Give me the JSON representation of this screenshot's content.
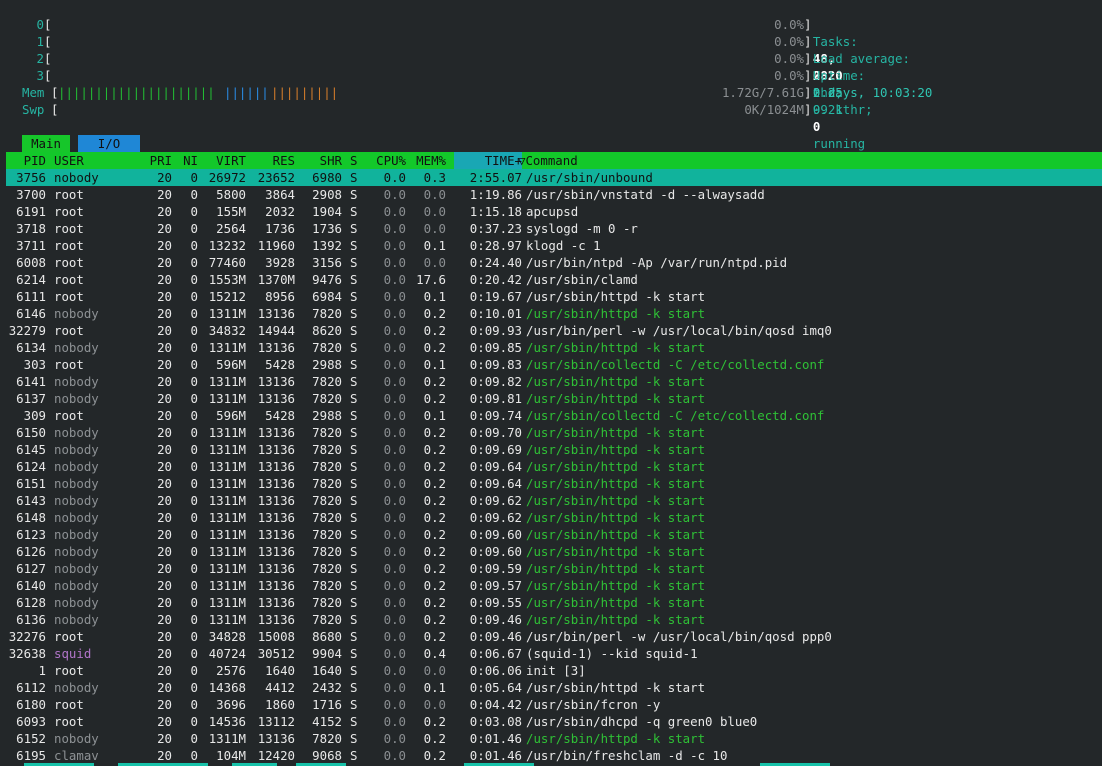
{
  "cpus": [
    {
      "id": "0",
      "pct": "0.0%"
    },
    {
      "id": "1",
      "pct": "0.0%"
    },
    {
      "id": "2",
      "pct": "0.0%"
    },
    {
      "id": "3",
      "pct": "0.0%"
    }
  ],
  "mem": {
    "label": "Mem",
    "bar_green": "|||||||||||||||||||||",
    "bar_blue": "||||||",
    "bar_orange": "|||||||||",
    "value": "1.72G/7.61G"
  },
  "swp": {
    "label": "Swp",
    "value": "0K/1024M"
  },
  "tasks": {
    "label": "Tasks:",
    "count": "48,",
    "thr": "28",
    "thr_label": "thr,",
    "kthr": "99 kthr;",
    "running": "0",
    "running_label": "running"
  },
  "load": {
    "label": "Load average:",
    "l1": "0.20",
    "l5": "0.25",
    "l15": "0.21"
  },
  "uptime": {
    "label": "Uptime:",
    "value": "2 days, 10:03:20"
  },
  "tabs": [
    {
      "label": "Main"
    },
    {
      "label": "I/O"
    }
  ],
  "columns": {
    "pid": "PID",
    "user": "USER",
    "pri": "PRI",
    "ni": "NI",
    "virt": "VIRT",
    "res": "RES",
    "shr": "SHR",
    "s": "S",
    "cpu": "CPU%",
    "mem": "MEM%",
    "time": "TIME+",
    "cmd": "▽Command"
  },
  "processes": [
    {
      "pid": "3756",
      "user": "nobody",
      "pri": "20",
      "ni": "0",
      "virt": "26972",
      "res": "23652",
      "shr": "6980",
      "s": "S",
      "cpu": "0.0",
      "mem": "0.3",
      "time": "2:55.07",
      "cmd": "/usr/sbin/unbound",
      "thread": false
    },
    {
      "pid": "3700",
      "user": "root",
      "pri": "20",
      "ni": "0",
      "virt": "5800",
      "res": "3864",
      "shr": "2908",
      "s": "S",
      "cpu": "0.0",
      "mem": "0.0",
      "time": "1:19.86",
      "cmd": "/usr/sbin/vnstatd -d --alwaysadd",
      "thread": false
    },
    {
      "pid": "6191",
      "user": "root",
      "pri": "20",
      "ni": "0",
      "virt": "155M",
      "res": "2032",
      "shr": "1904",
      "s": "S",
      "cpu": "0.0",
      "mem": "0.0",
      "time": "1:15.18",
      "cmd": "apcupsd",
      "thread": false
    },
    {
      "pid": "3718",
      "user": "root",
      "pri": "20",
      "ni": "0",
      "virt": "2564",
      "res": "1736",
      "shr": "1736",
      "s": "S",
      "cpu": "0.0",
      "mem": "0.0",
      "time": "0:37.23",
      "cmd": "syslogd -m 0 -r",
      "thread": false
    },
    {
      "pid": "3711",
      "user": "root",
      "pri": "20",
      "ni": "0",
      "virt": "13232",
      "res": "11960",
      "shr": "1392",
      "s": "S",
      "cpu": "0.0",
      "mem": "0.1",
      "time": "0:28.97",
      "cmd": "klogd -c 1",
      "thread": false
    },
    {
      "pid": "6008",
      "user": "root",
      "pri": "20",
      "ni": "0",
      "virt": "77460",
      "res": "3928",
      "shr": "3156",
      "s": "S",
      "cpu": "0.0",
      "mem": "0.0",
      "time": "0:24.40",
      "cmd": "/usr/bin/ntpd -Ap /var/run/ntpd.pid",
      "thread": false
    },
    {
      "pid": "6214",
      "user": "root",
      "pri": "20",
      "ni": "0",
      "virt": "1553M",
      "res": "1370M",
      "shr": "9476",
      "s": "S",
      "cpu": "0.0",
      "mem": "17.6",
      "time": "0:20.42",
      "cmd": "/usr/sbin/clamd",
      "thread": false
    },
    {
      "pid": "6111",
      "user": "root",
      "pri": "20",
      "ni": "0",
      "virt": "15212",
      "res": "8956",
      "shr": "6984",
      "s": "S",
      "cpu": "0.0",
      "mem": "0.1",
      "time": "0:19.67",
      "cmd": "/usr/sbin/httpd -k start",
      "thread": false
    },
    {
      "pid": "6146",
      "user": "nobody",
      "pri": "20",
      "ni": "0",
      "virt": "1311M",
      "res": "13136",
      "shr": "7820",
      "s": "S",
      "cpu": "0.0",
      "mem": "0.2",
      "time": "0:10.01",
      "cmd": "/usr/sbin/httpd -k start",
      "thread": true
    },
    {
      "pid": "32279",
      "user": "root",
      "pri": "20",
      "ni": "0",
      "virt": "34832",
      "res": "14944",
      "shr": "8620",
      "s": "S",
      "cpu": "0.0",
      "mem": "0.2",
      "time": "0:09.93",
      "cmd": "/usr/bin/perl -w /usr/local/bin/qosd imq0",
      "thread": false
    },
    {
      "pid": "6134",
      "user": "nobody",
      "pri": "20",
      "ni": "0",
      "virt": "1311M",
      "res": "13136",
      "shr": "7820",
      "s": "S",
      "cpu": "0.0",
      "mem": "0.2",
      "time": "0:09.85",
      "cmd": "/usr/sbin/httpd -k start",
      "thread": true
    },
    {
      "pid": "303",
      "user": "root",
      "pri": "20",
      "ni": "0",
      "virt": "596M",
      "res": "5428",
      "shr": "2988",
      "s": "S",
      "cpu": "0.0",
      "mem": "0.1",
      "time": "0:09.83",
      "cmd": "/usr/sbin/collectd -C /etc/collectd.conf",
      "thread": true
    },
    {
      "pid": "6141",
      "user": "nobody",
      "pri": "20",
      "ni": "0",
      "virt": "1311M",
      "res": "13136",
      "shr": "7820",
      "s": "S",
      "cpu": "0.0",
      "mem": "0.2",
      "time": "0:09.82",
      "cmd": "/usr/sbin/httpd -k start",
      "thread": true
    },
    {
      "pid": "6137",
      "user": "nobody",
      "pri": "20",
      "ni": "0",
      "virt": "1311M",
      "res": "13136",
      "shr": "7820",
      "s": "S",
      "cpu": "0.0",
      "mem": "0.2",
      "time": "0:09.81",
      "cmd": "/usr/sbin/httpd -k start",
      "thread": true
    },
    {
      "pid": "309",
      "user": "root",
      "pri": "20",
      "ni": "0",
      "virt": "596M",
      "res": "5428",
      "shr": "2988",
      "s": "S",
      "cpu": "0.0",
      "mem": "0.1",
      "time": "0:09.74",
      "cmd": "/usr/sbin/collectd -C /etc/collectd.conf",
      "thread": true
    },
    {
      "pid": "6150",
      "user": "nobody",
      "pri": "20",
      "ni": "0",
      "virt": "1311M",
      "res": "13136",
      "shr": "7820",
      "s": "S",
      "cpu": "0.0",
      "mem": "0.2",
      "time": "0:09.70",
      "cmd": "/usr/sbin/httpd -k start",
      "thread": true
    },
    {
      "pid": "6145",
      "user": "nobody",
      "pri": "20",
      "ni": "0",
      "virt": "1311M",
      "res": "13136",
      "shr": "7820",
      "s": "S",
      "cpu": "0.0",
      "mem": "0.2",
      "time": "0:09.69",
      "cmd": "/usr/sbin/httpd -k start",
      "thread": true
    },
    {
      "pid": "6124",
      "user": "nobody",
      "pri": "20",
      "ni": "0",
      "virt": "1311M",
      "res": "13136",
      "shr": "7820",
      "s": "S",
      "cpu": "0.0",
      "mem": "0.2",
      "time": "0:09.64",
      "cmd": "/usr/sbin/httpd -k start",
      "thread": true
    },
    {
      "pid": "6151",
      "user": "nobody",
      "pri": "20",
      "ni": "0",
      "virt": "1311M",
      "res": "13136",
      "shr": "7820",
      "s": "S",
      "cpu": "0.0",
      "mem": "0.2",
      "time": "0:09.64",
      "cmd": "/usr/sbin/httpd -k start",
      "thread": true
    },
    {
      "pid": "6143",
      "user": "nobody",
      "pri": "20",
      "ni": "0",
      "virt": "1311M",
      "res": "13136",
      "shr": "7820",
      "s": "S",
      "cpu": "0.0",
      "mem": "0.2",
      "time": "0:09.62",
      "cmd": "/usr/sbin/httpd -k start",
      "thread": true
    },
    {
      "pid": "6148",
      "user": "nobody",
      "pri": "20",
      "ni": "0",
      "virt": "1311M",
      "res": "13136",
      "shr": "7820",
      "s": "S",
      "cpu": "0.0",
      "mem": "0.2",
      "time": "0:09.62",
      "cmd": "/usr/sbin/httpd -k start",
      "thread": true
    },
    {
      "pid": "6123",
      "user": "nobody",
      "pri": "20",
      "ni": "0",
      "virt": "1311M",
      "res": "13136",
      "shr": "7820",
      "s": "S",
      "cpu": "0.0",
      "mem": "0.2",
      "time": "0:09.60",
      "cmd": "/usr/sbin/httpd -k start",
      "thread": true
    },
    {
      "pid": "6126",
      "user": "nobody",
      "pri": "20",
      "ni": "0",
      "virt": "1311M",
      "res": "13136",
      "shr": "7820",
      "s": "S",
      "cpu": "0.0",
      "mem": "0.2",
      "time": "0:09.60",
      "cmd": "/usr/sbin/httpd -k start",
      "thread": true
    },
    {
      "pid": "6127",
      "user": "nobody",
      "pri": "20",
      "ni": "0",
      "virt": "1311M",
      "res": "13136",
      "shr": "7820",
      "s": "S",
      "cpu": "0.0",
      "mem": "0.2",
      "time": "0:09.59",
      "cmd": "/usr/sbin/httpd -k start",
      "thread": true
    },
    {
      "pid": "6140",
      "user": "nobody",
      "pri": "20",
      "ni": "0",
      "virt": "1311M",
      "res": "13136",
      "shr": "7820",
      "s": "S",
      "cpu": "0.0",
      "mem": "0.2",
      "time": "0:09.57",
      "cmd": "/usr/sbin/httpd -k start",
      "thread": true
    },
    {
      "pid": "6128",
      "user": "nobody",
      "pri": "20",
      "ni": "0",
      "virt": "1311M",
      "res": "13136",
      "shr": "7820",
      "s": "S",
      "cpu": "0.0",
      "mem": "0.2",
      "time": "0:09.55",
      "cmd": "/usr/sbin/httpd -k start",
      "thread": true
    },
    {
      "pid": "6136",
      "user": "nobody",
      "pri": "20",
      "ni": "0",
      "virt": "1311M",
      "res": "13136",
      "shr": "7820",
      "s": "S",
      "cpu": "0.0",
      "mem": "0.2",
      "time": "0:09.46",
      "cmd": "/usr/sbin/httpd -k start",
      "thread": true
    },
    {
      "pid": "32276",
      "user": "root",
      "pri": "20",
      "ni": "0",
      "virt": "34828",
      "res": "15008",
      "shr": "8680",
      "s": "S",
      "cpu": "0.0",
      "mem": "0.2",
      "time": "0:09.46",
      "cmd": "/usr/bin/perl -w /usr/local/bin/qosd ppp0",
      "thread": false
    },
    {
      "pid": "32638",
      "user": "squid",
      "pri": "20",
      "ni": "0",
      "virt": "40724",
      "res": "30512",
      "shr": "9904",
      "s": "S",
      "cpu": "0.0",
      "mem": "0.4",
      "time": "0:06.67",
      "cmd": "(squid-1) --kid squid-1",
      "thread": false
    },
    {
      "pid": "1",
      "user": "root",
      "pri": "20",
      "ni": "0",
      "virt": "2576",
      "res": "1640",
      "shr": "1640",
      "s": "S",
      "cpu": "0.0",
      "mem": "0.0",
      "time": "0:06.06",
      "cmd": "init [3]",
      "thread": false
    },
    {
      "pid": "6112",
      "user": "nobody",
      "pri": "20",
      "ni": "0",
      "virt": "14368",
      "res": "4412",
      "shr": "2432",
      "s": "S",
      "cpu": "0.0",
      "mem": "0.1",
      "time": "0:05.64",
      "cmd": "/usr/sbin/httpd -k start",
      "thread": false
    },
    {
      "pid": "6180",
      "user": "root",
      "pri": "20",
      "ni": "0",
      "virt": "3696",
      "res": "1860",
      "shr": "1716",
      "s": "S",
      "cpu": "0.0",
      "mem": "0.0",
      "time": "0:04.42",
      "cmd": "/usr/sbin/fcron -y",
      "thread": false
    },
    {
      "pid": "6093",
      "user": "root",
      "pri": "20",
      "ni": "0",
      "virt": "14536",
      "res": "13112",
      "shr": "4152",
      "s": "S",
      "cpu": "0.0",
      "mem": "0.2",
      "time": "0:03.08",
      "cmd": "/usr/sbin/dhcpd -q green0 blue0",
      "thread": false
    },
    {
      "pid": "6152",
      "user": "nobody",
      "pri": "20",
      "ni": "0",
      "virt": "1311M",
      "res": "13136",
      "shr": "7820",
      "s": "S",
      "cpu": "0.0",
      "mem": "0.2",
      "time": "0:01.46",
      "cmd": "/usr/sbin/httpd -k start",
      "thread": true
    },
    {
      "pid": "6195",
      "user": "clamav",
      "pri": "20",
      "ni": "0",
      "virt": "104M",
      "res": "12420",
      "shr": "9068",
      "s": "S",
      "cpu": "0.0",
      "mem": "0.2",
      "time": "0:01.46",
      "cmd": "/usr/bin/freshclam -d -c 10",
      "thread": false
    }
  ]
}
